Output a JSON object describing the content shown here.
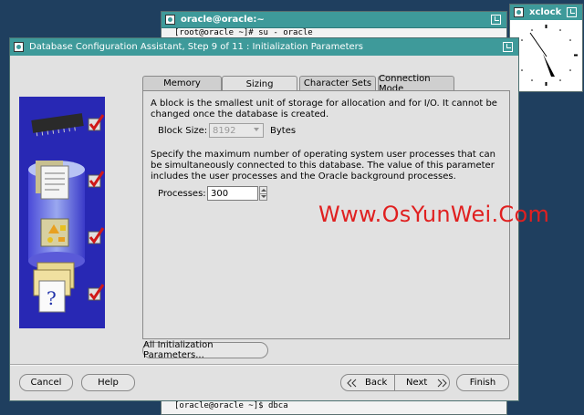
{
  "terminal": {
    "title": "oracle@oracle:~",
    "line_top": "[root@oracle ~]# su - oracle",
    "line_bottom": "[oracle@oracle ~]$ dbca"
  },
  "xclock": {
    "title": "xclock"
  },
  "dialog": {
    "title": "Database Configuration Assistant, Step 9 of 11 : Initialization Parameters",
    "tabs": [
      {
        "label": "Memory"
      },
      {
        "label": "Sizing"
      },
      {
        "label": "Character Sets"
      },
      {
        "label": "Connection Mode"
      }
    ],
    "active_tab": "Sizing",
    "block_desc": "A block is the smallest unit of storage for allocation and for I/O. It cannot be changed once the database is created.",
    "block_size_label": "Block Size:",
    "block_size_value": "8192",
    "block_size_unit": "Bytes",
    "process_desc": "Specify the maximum number of operating system user processes that can be simultaneously connected to this database. The value of this parameter includes the user processes and the Oracle background processes.",
    "processes_label": "Processes:",
    "processes_value": "300",
    "all_params_button": "All Initialization Parameters...",
    "cancel_button": "Cancel",
    "help_button": "Help",
    "back_button": "Back",
    "next_button": "Next",
    "finish_button": "Finish"
  },
  "watermark": "Www.OsYunWei.Com",
  "colors": {
    "desktop": "#1f3f5f",
    "titlebar": "#3e9a9a",
    "dialog_bg": "#e1e1e1",
    "side_panel": "#2828b4",
    "watermark": "#e02020",
    "checkmark": "#d01818"
  }
}
